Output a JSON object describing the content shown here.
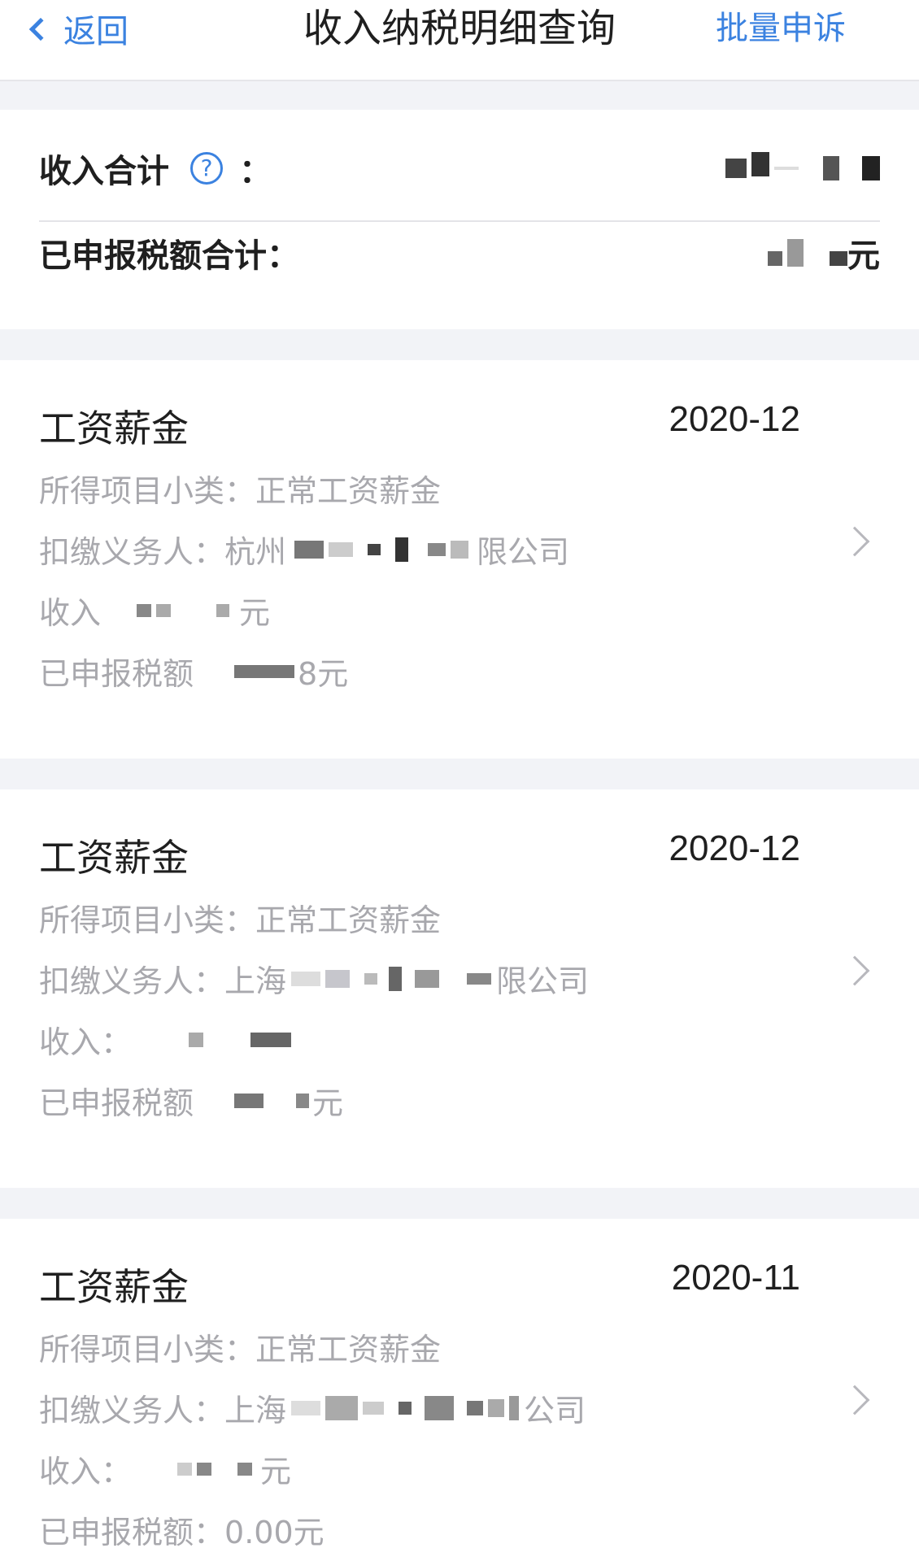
{
  "navbar": {
    "back_label": "返回",
    "title": "收入纳税明细查询",
    "action_label": "批量申诉"
  },
  "summary": {
    "income_total_label": "收入合计",
    "income_colon": "：",
    "help_symbol": "?",
    "tax_total_label": "已申报税额合计：",
    "tax_total_unit": "元"
  },
  "records": [
    {
      "title": "工资薪金",
      "date": "2020-12",
      "subcategory_label": "所得项目小类：",
      "subcategory_value": "正常工资薪金",
      "withholder_label": "扣缴义务人：",
      "withholder_prefix": "杭州",
      "withholder_suffix": "限公司",
      "income_label": "收入",
      "income_unit": "元",
      "tax_label": "已申报税额",
      "tax_unit": "8元"
    },
    {
      "title": "工资薪金",
      "date": "2020-12",
      "subcategory_label": "所得项目小类：",
      "subcategory_value": "正常工资薪金",
      "withholder_label": "扣缴义务人：",
      "withholder_prefix": "上海",
      "withholder_suffix": "限公司",
      "income_label": "收入：",
      "income_unit": "",
      "tax_label": "已申报税额",
      "tax_unit": "元"
    },
    {
      "title": "工资薪金",
      "date": "2020-11",
      "subcategory_label": "所得项目小类：",
      "subcategory_value": "正常工资薪金",
      "withholder_label": "扣缴义务人：",
      "withholder_prefix": "上海",
      "withholder_suffix": "公司",
      "income_label": "收入：",
      "income_unit": "元",
      "tax_label": "已申报税额：",
      "tax_unit": "0.00元"
    }
  ],
  "colors": {
    "accent": "#3b82e0",
    "background_gap": "#f2f3f7",
    "secondary_text": "#a8a8ad"
  }
}
